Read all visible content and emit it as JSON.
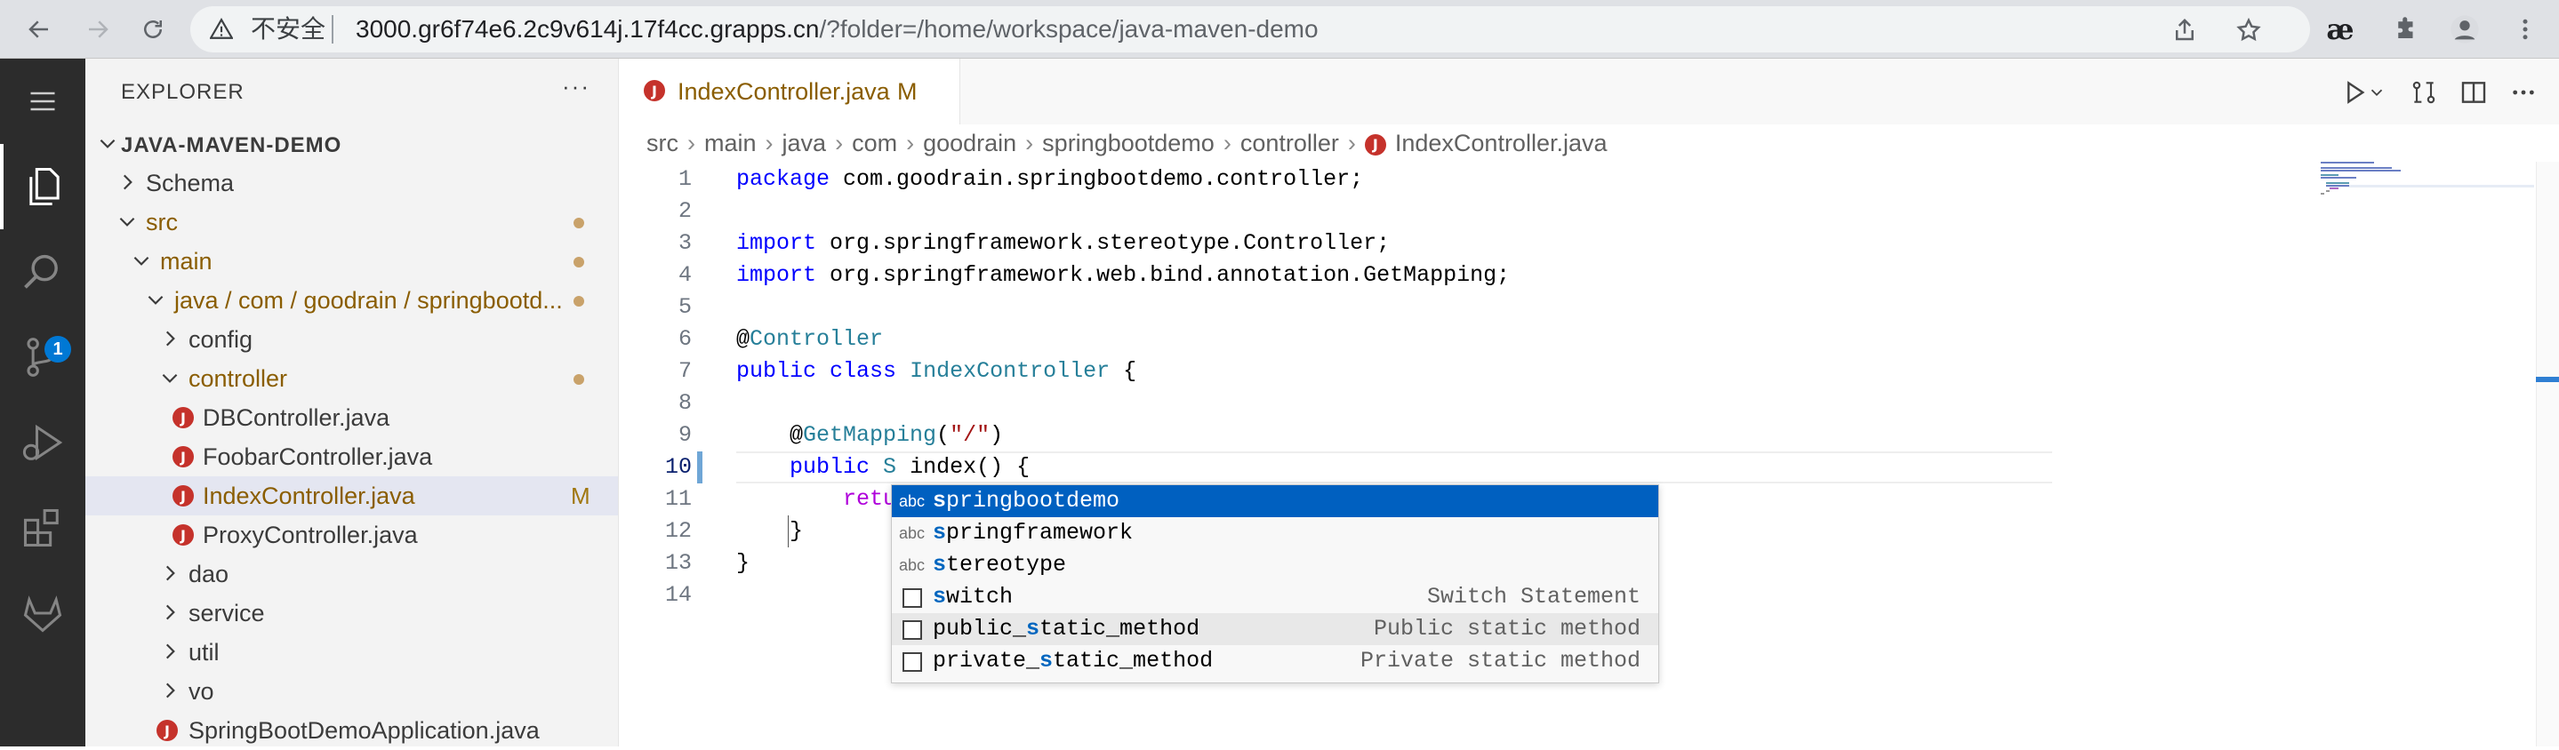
{
  "browser": {
    "insecure_label": "不安全",
    "url_host": "3000.gr6f74e6.2c9v614j.17f4cc.grapps.cn",
    "url_rest": "/?folder=/home/workspace/java-maven-demo",
    "ae_label": "æ"
  },
  "activity_bar": {
    "items": [
      "explorer",
      "search",
      "source-control",
      "run-and-debug",
      "extensions",
      "gitlab"
    ],
    "source_control_badge": "1"
  },
  "explorer": {
    "title": "EXPLORER",
    "more": "···",
    "root": "JAVA-MAVEN-DEMO",
    "rows": [
      {
        "label": "Schema",
        "type": "folder",
        "open": false
      },
      {
        "label": "src",
        "type": "folder",
        "open": true,
        "modified_dot": true
      },
      {
        "label": "main",
        "type": "folder",
        "open": true,
        "modified_dot": true
      },
      {
        "label": "java / com / goodrain / springbootd...",
        "type": "folder",
        "open": true,
        "modified_dot": true
      },
      {
        "label": "config",
        "type": "folder",
        "open": false
      },
      {
        "label": "controller",
        "type": "folder",
        "open": true,
        "modified_dot": true
      },
      {
        "label": "DBController.java",
        "type": "java"
      },
      {
        "label": "FoobarController.java",
        "type": "java"
      },
      {
        "label": "IndexController.java",
        "type": "java",
        "selected": true,
        "flag": "M"
      },
      {
        "label": "ProxyController.java",
        "type": "java"
      },
      {
        "label": "dao",
        "type": "folder",
        "open": false
      },
      {
        "label": "service",
        "type": "folder",
        "open": false
      },
      {
        "label": "util",
        "type": "folder",
        "open": false
      },
      {
        "label": "vo",
        "type": "folder",
        "open": false
      },
      {
        "label": "SpringBootDemoApplication.java",
        "type": "java"
      }
    ]
  },
  "editor": {
    "tab": {
      "label": "IndexController.java",
      "flag": "M",
      "icon_letter": "J"
    },
    "breadcrumb": [
      "src",
      "main",
      "java",
      "com",
      "goodrain",
      "springbootdemo",
      "controller",
      "IndexController.java"
    ],
    "line_numbers": [
      "1",
      "2",
      "3",
      "4",
      "5",
      "6",
      "7",
      "8",
      "9",
      "10",
      "11",
      "12",
      "13",
      "14"
    ],
    "current_line": "10",
    "code": {
      "l1_kw": "package",
      "l1_rest": " com.goodrain.springbootdemo.controller;",
      "l3_kw": "import",
      "l3_rest": " org.springframework.stereotype.Controller;",
      "l4_kw": "import",
      "l4_rest": " org.springframework.web.bind.annotation.GetMapping;",
      "l6_at": "@",
      "l6_ty": "Controller",
      "l7_kw1": "public",
      "l7_kw2": "class",
      "l7_ty": "IndexController",
      "l7_brace": " {",
      "l9_at": "    @",
      "l9_ty": "GetMapping",
      "l9_open": "(",
      "l9_str": "\"/\"",
      "l9_close": ")",
      "l10_kw": "    public",
      "l10_ty": "S",
      "l10_rest": " index() {",
      "l11_ctrl": "        retu",
      "l12": "    }",
      "l13": "}"
    }
  },
  "suggest": {
    "items": [
      {
        "kind": "abc",
        "match": "s",
        "rest": "pringbootdemo",
        "detail": "",
        "focused": true
      },
      {
        "kind": "abc",
        "match": "s",
        "rest": "pringframework",
        "detail": ""
      },
      {
        "kind": "abc",
        "match": "s",
        "rest": "tereotype",
        "detail": ""
      },
      {
        "kind": "snippet",
        "match": "s",
        "rest": "witch",
        "detail": "Switch Statement"
      },
      {
        "kind": "snippet",
        "prefix": "public_",
        "match": "s",
        "rest": "tatic_method",
        "detail": "Public static method",
        "hover": true
      },
      {
        "kind": "snippet",
        "prefix": "private_",
        "match": "s",
        "rest": "tatic_method",
        "detail": "Private static method"
      }
    ]
  }
}
